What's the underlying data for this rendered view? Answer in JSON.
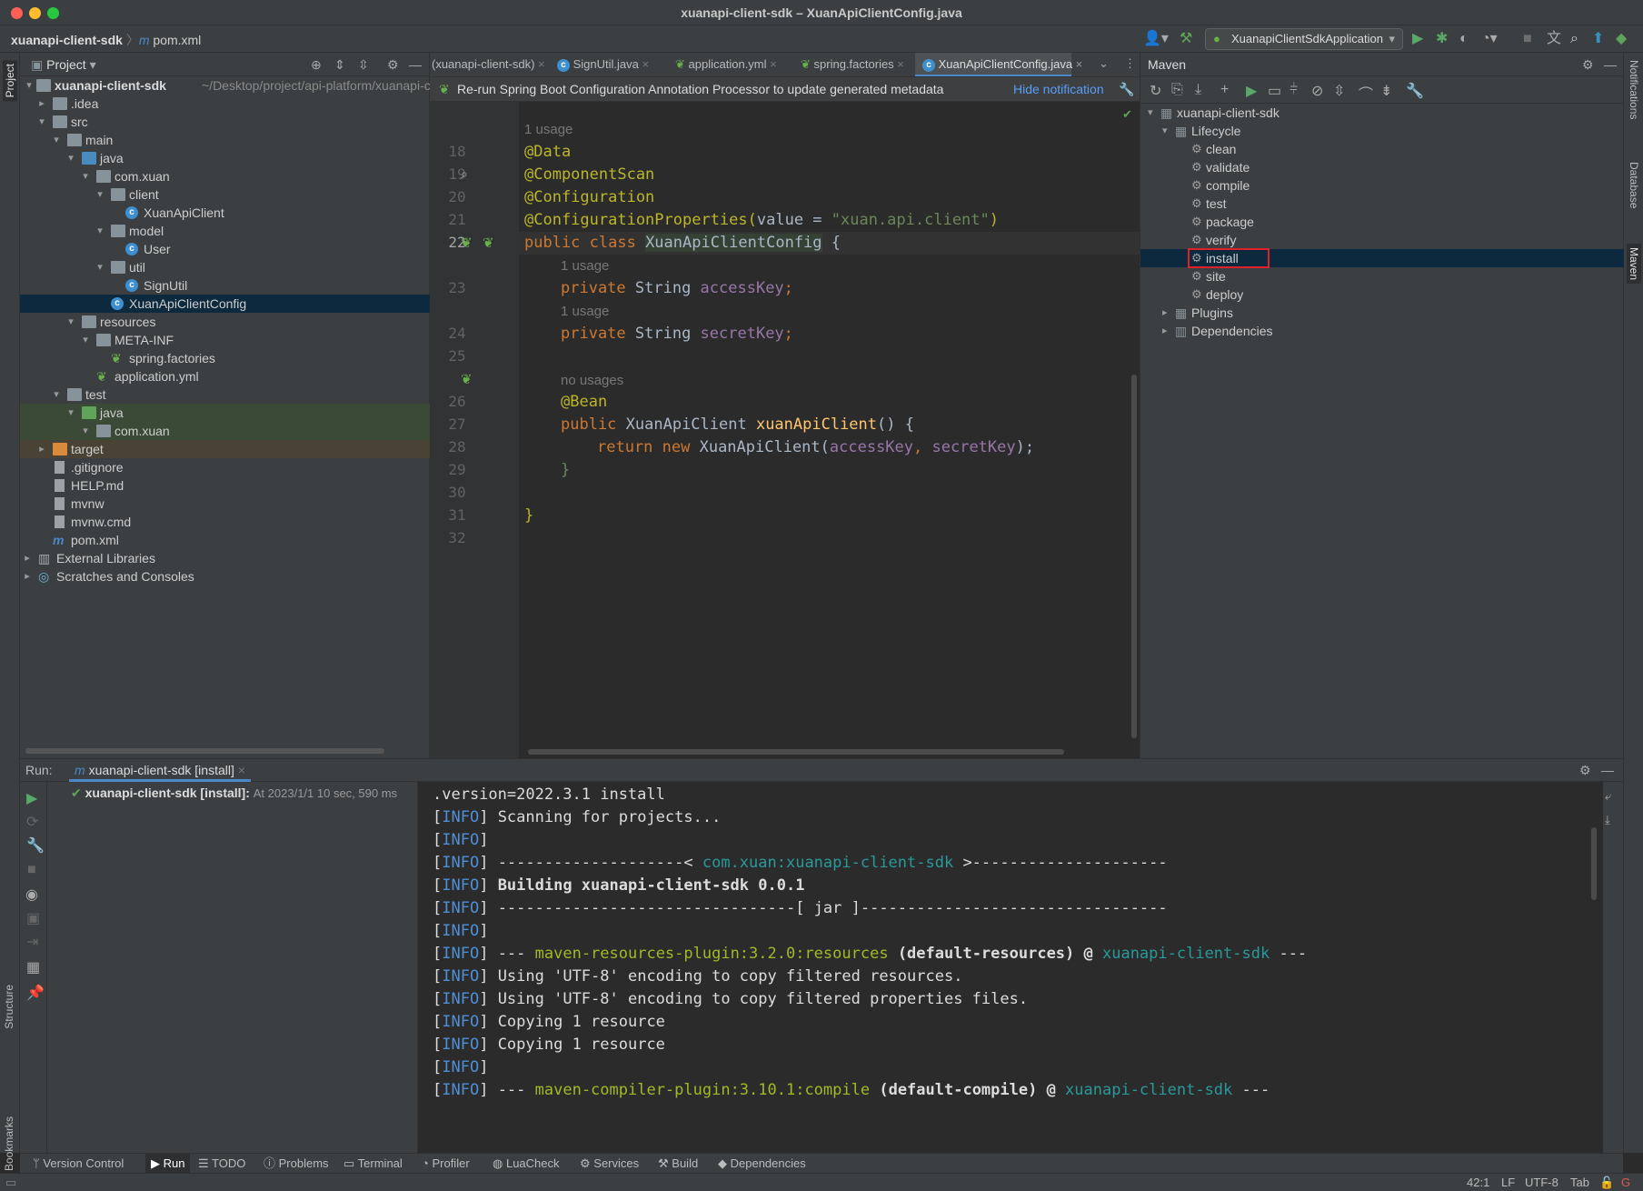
{
  "window": {
    "title": "xuanapi-client-sdk – XuanApiClientConfig.java"
  },
  "toolbar": {
    "crumb_project": "xuanapi-client-sdk",
    "crumb_file": "pom.xml",
    "run_config": "XuanapiClientSdkApplication"
  },
  "project_panel": {
    "title": "Project",
    "root_name": "xuanapi-client-sdk",
    "root_path": "~/Desktop/project/api-platform/xuanapi-cl",
    "items": [
      {
        "label": ".idea"
      },
      {
        "label": "src"
      },
      {
        "label": "main"
      },
      {
        "label": "java"
      },
      {
        "label": "com.xuan"
      },
      {
        "label": "client"
      },
      {
        "label": "XuanApiClient"
      },
      {
        "label": "model"
      },
      {
        "label": "User"
      },
      {
        "label": "util"
      },
      {
        "label": "SignUtil"
      },
      {
        "label": "XuanApiClientConfig"
      },
      {
        "label": "resources"
      },
      {
        "label": "META-INF"
      },
      {
        "label": "spring.factories"
      },
      {
        "label": "application.yml"
      },
      {
        "label": "test"
      },
      {
        "label": "java"
      },
      {
        "label": "com.xuan"
      },
      {
        "label": "target"
      },
      {
        "label": ".gitignore"
      },
      {
        "label": "HELP.md"
      },
      {
        "label": "mvnw"
      },
      {
        "label": "mvnw.cmd"
      },
      {
        "label": "pom.xml"
      },
      {
        "label": "External Libraries"
      },
      {
        "label": "Scratches and Consoles"
      }
    ]
  },
  "editor": {
    "tabs": [
      {
        "label": "(xuanapi-client-sdk)"
      },
      {
        "label": "SignUtil.java"
      },
      {
        "label": "application.yml"
      },
      {
        "label": "spring.factories"
      },
      {
        "label": "XuanApiClientConfig.java"
      }
    ],
    "notification": "Re-run Spring Boot Configuration Annotation Processor to update generated metadata",
    "hide_notification": "Hide notification",
    "hints": {
      "usage1": "1 usage",
      "usage2": "1 usage",
      "usage3": "1 usage",
      "nousages": "no usages"
    },
    "line_numbers": [
      "18",
      "19",
      "20",
      "21",
      "22",
      "23",
      "24",
      "25",
      "26",
      "27",
      "28",
      "29",
      "30",
      "31",
      "32"
    ],
    "code": {
      "l18": "@Data",
      "l19": "@ComponentScan",
      "l20": "@Configuration",
      "l21a": "@ConfigurationProperties(",
      "l21b": "value = ",
      "l21c": "\"xuan.api.client\"",
      "l21d": ")",
      "l22a": "public class ",
      "l22b": "XuanApiClientConfig",
      "l22c": " {",
      "l23a": "private ",
      "l23b": "String ",
      "l23c": "accessKey",
      "l23d": ";",
      "l24a": "private ",
      "l24b": "String ",
      "l24c": "secretKey",
      "l24d": ";",
      "l26": "@Bean",
      "l27a": "public ",
      "l27b": "XuanApiClient ",
      "l27c": "xuanApiClient",
      "l27d": "() {",
      "l28a": "return new ",
      "l28b": "XuanApiClient(",
      "l28c": "accessKey",
      "l28d": ", ",
      "l28e": "secretKey",
      "l28f": ");",
      "l29": "}",
      "l31": "}"
    }
  },
  "maven": {
    "title": "Maven",
    "root": "xuanapi-client-sdk",
    "lifecycle": "Lifecycle",
    "goals": [
      "clean",
      "validate",
      "compile",
      "test",
      "package",
      "verify",
      "install",
      "site",
      "deploy"
    ],
    "selected_goal": "install",
    "plugins": "Plugins",
    "dependencies": "Dependencies"
  },
  "run": {
    "label": "Run:",
    "tab": "xuanapi-client-sdk [install]",
    "tree_item": "xuanapi-client-sdk [install]:",
    "tree_detail": "At 2023/1/1 10 sec, 590 ms",
    "console": [
      {
        "prefix": "",
        "text": ".version=2022.3.1 install"
      },
      {
        "prefix": "[INFO]",
        "text": " Scanning for projects..."
      },
      {
        "prefix": "[INFO]",
        "text": ""
      },
      {
        "prefix": "[INFO]",
        "text": " --------------------< ",
        "cyan": "com.xuan:xuanapi-client-sdk",
        "tail": " >---------------------"
      },
      {
        "prefix": "[INFO]",
        "text": " Building xuanapi-client-sdk 0.0.1",
        "bold": true
      },
      {
        "prefix": "[INFO]",
        "text": " --------------------------------[ jar ]---------------------------------"
      },
      {
        "prefix": "[INFO]",
        "text": ""
      },
      {
        "prefix": "[INFO]",
        "text": " --- ",
        "green": "maven-resources-plugin:3.2.0:resources",
        "mid": " (default-resources) @ ",
        "cyan2": "xuanapi-client-sdk",
        "tail": " ---"
      },
      {
        "prefix": "[INFO]",
        "text": " Using 'UTF-8' encoding to copy filtered resources."
      },
      {
        "prefix": "[INFO]",
        "text": " Using 'UTF-8' encoding to copy filtered properties files."
      },
      {
        "prefix": "[INFO]",
        "text": " Copying 1 resource"
      },
      {
        "prefix": "[INFO]",
        "text": " Copying 1 resource"
      },
      {
        "prefix": "[INFO]",
        "text": ""
      },
      {
        "prefix": "[INFO]",
        "text": " --- ",
        "green": "maven-compiler-plugin:3.10.1:compile",
        "mid": " (default-compile) @ ",
        "cyan2": "xuanapi-client-sdk",
        "tail": " ---"
      }
    ]
  },
  "bottom_tabs": [
    "Version Control",
    "Run",
    "TODO",
    "Problems",
    "Terminal",
    "Profiler",
    "LuaCheck",
    "Services",
    "Build",
    "Dependencies"
  ],
  "status": {
    "position": "42:1",
    "line_sep": "LF",
    "encoding": "UTF-8",
    "indent": "Tab"
  },
  "side_stripes": {
    "project": "Project",
    "structure": "Structure",
    "bookmarks": "Bookmarks",
    "notifications": "Notifications",
    "database": "Database",
    "maven": "Maven"
  }
}
